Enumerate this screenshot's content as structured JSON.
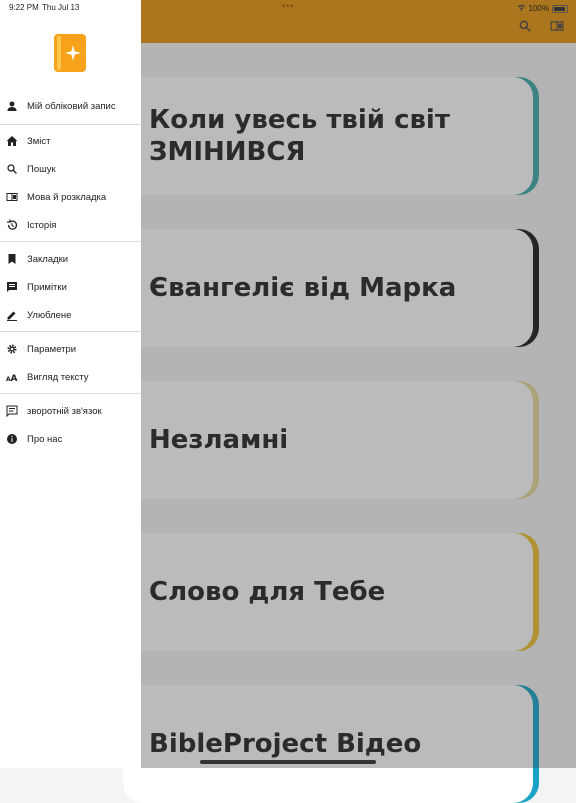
{
  "status_bar": {
    "time": "9:22 PM",
    "date": "Thu Jul 13",
    "battery": "100%"
  },
  "app_bar": {
    "color": "#e8960f",
    "icons": [
      "search-icon",
      "book-icon"
    ]
  },
  "drawer": {
    "account": {
      "label": "Мій обліковий запис",
      "icon": "person-icon"
    },
    "nav": [
      {
        "label": "Зміст",
        "icon": "home-icon"
      },
      {
        "label": "Пошук",
        "icon": "search-icon"
      },
      {
        "label": "Мова й розкладка",
        "icon": "book-icon"
      },
      {
        "label": "Історія",
        "icon": "history-icon"
      }
    ],
    "library": [
      {
        "label": "Закладки",
        "icon": "bookmark-icon"
      },
      {
        "label": "Примітки",
        "icon": "note-icon"
      },
      {
        "label": "Улюблене",
        "icon": "pencil-icon"
      }
    ],
    "settings": [
      {
        "label": "Параметри",
        "icon": "gear-icon"
      },
      {
        "label": "Вигляд тексту",
        "icon": "text-size-icon"
      }
    ],
    "about": [
      {
        "label": "зворотній зв'язок",
        "icon": "feedback-icon"
      },
      {
        "label": "Про нас",
        "icon": "info-icon"
      }
    ]
  },
  "cards": [
    {
      "title": "Коли увесь твій світ ЗМІНИВСЯ",
      "accent": "#3fa9a9"
    },
    {
      "title": "Євангеліє від Марка",
      "accent": "#1a1a1a"
    },
    {
      "title": "Незламні",
      "accent": "#e8d99a"
    },
    {
      "title": "Слово для Тебе",
      "accent": "#f2c230"
    },
    {
      "title": "BibleProject Відео",
      "accent": "#1aa3c6"
    }
  ]
}
